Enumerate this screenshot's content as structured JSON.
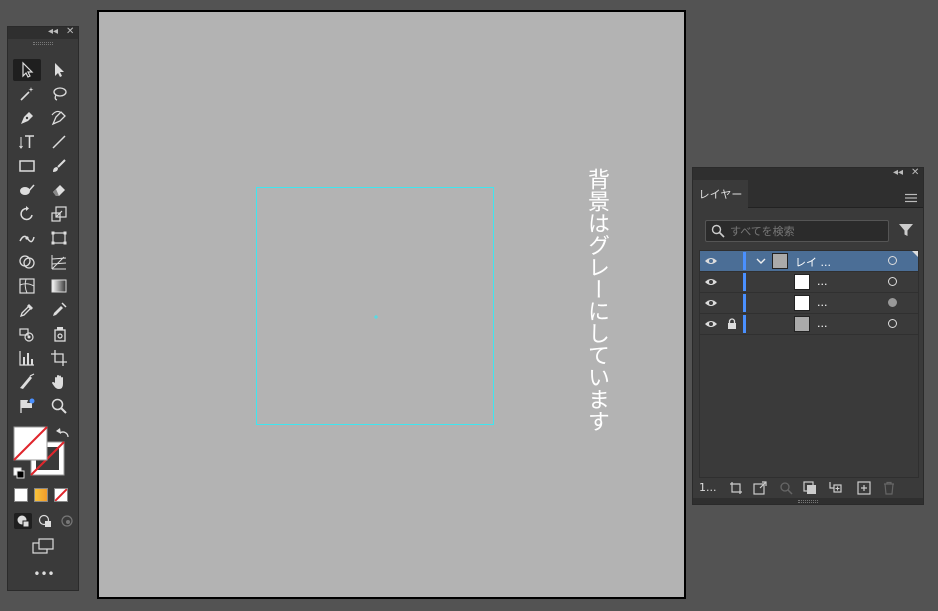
{
  "toolbar": {
    "collapse_glyph": "◂◂",
    "close_glyph": "✕",
    "tools": [
      {
        "name": "selection-tool-icon",
        "active": true
      },
      {
        "name": "direct-selection-tool-icon"
      },
      {
        "name": "magic-wand-tool-icon"
      },
      {
        "name": "lasso-tool-icon"
      },
      {
        "name": "pen-tool-icon"
      },
      {
        "name": "curvature-tool-icon"
      },
      {
        "name": "type-tool-icon"
      },
      {
        "name": "line-segment-tool-icon"
      },
      {
        "name": "rectangle-tool-icon"
      },
      {
        "name": "paintbrush-tool-icon"
      },
      {
        "name": "shaper-tool-icon"
      },
      {
        "name": "eraser-tool-icon"
      },
      {
        "name": "rotate-tool-icon"
      },
      {
        "name": "scale-tool-icon"
      },
      {
        "name": "width-tool-icon"
      },
      {
        "name": "free-transform-tool-icon"
      },
      {
        "name": "shape-builder-tool-icon"
      },
      {
        "name": "perspective-grid-tool-icon"
      },
      {
        "name": "mesh-tool-icon"
      },
      {
        "name": "gradient-tool-icon"
      },
      {
        "name": "eyedropper-tool-icon"
      },
      {
        "name": "measure-tool-icon"
      },
      {
        "name": "symbol-sprayer-tool-icon"
      },
      {
        "name": "live-paint-bucket-icon"
      },
      {
        "name": "column-graph-tool-icon"
      },
      {
        "name": "artboard-tool-icon"
      },
      {
        "name": "slice-tool-icon"
      },
      {
        "name": "hand-tool-icon"
      },
      {
        "name": "puppet-warp-tool-icon"
      },
      {
        "name": "zoom-tool-icon"
      }
    ],
    "more_label": "•••"
  },
  "canvas": {
    "vertical_text": "背景はグレーにしています",
    "selection_color": "#3ee6f0",
    "artboard_color": "#b3b3b3"
  },
  "layers_panel": {
    "tab_label": "レイヤー",
    "search_placeholder": "すべてを検索",
    "rows": [
      {
        "label": "レイ ...",
        "selected": true,
        "expanded": true,
        "locked": false,
        "thumb": "#aaaaaa",
        "target_filled": false
      },
      {
        "label": "...",
        "selected": false,
        "locked": false,
        "thumb": "#ffffff",
        "target_filled": false
      },
      {
        "label": "...",
        "selected": false,
        "locked": false,
        "thumb": "#ffffff",
        "target_filled": true
      },
      {
        "label": "...",
        "selected": false,
        "locked": true,
        "thumb": "#aaaaaa",
        "target_filled": false
      }
    ],
    "layer_count": "1...",
    "accent_color": "#4a90ff"
  }
}
